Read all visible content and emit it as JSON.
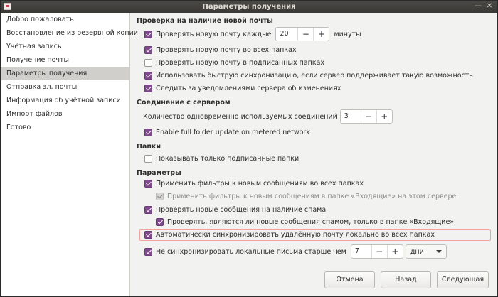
{
  "window": {
    "title": "Параметры получения",
    "close_glyph": "✕",
    "minimize_glyph": "—"
  },
  "sidebar": {
    "items": [
      {
        "label": "Добро пожаловать"
      },
      {
        "label": "Восстановление из резервной копии"
      },
      {
        "label": "Учётная запись"
      },
      {
        "label": "Получение почты"
      },
      {
        "label": "Параметры получения",
        "selected": true
      },
      {
        "label": "Отправка эл. почты"
      },
      {
        "label": "Информация об учётной записи"
      },
      {
        "label": "Импорт файлов"
      },
      {
        "label": "Готово"
      }
    ]
  },
  "sections": {
    "check_new_mail": {
      "title": "Проверка на наличие новой почты",
      "check_every_label": "Проверять новую почту каждые",
      "check_every_value": "20",
      "check_every_unit": "минуты",
      "all_folders_label": "Проверять новую почту во всех папках",
      "subscribed_folders_label": "Проверять новую почту в подписанных папках",
      "fast_sync_label": "Использовать быструю синхронизацию, если сервер поддерживает такую возможность",
      "notifications_label": "Следить за уведомлениями сервера об изменениях"
    },
    "server_connection": {
      "title": "Соединение с сервером",
      "connections_label": "Количество одновременно используемых соединений",
      "connections_value": "3",
      "metered_label": "Enable full folder update on metered network"
    },
    "folders": {
      "title": "Папки",
      "subscribed_only_label": "Показывать только подписанные папки"
    },
    "options": {
      "title": "Параметры",
      "filters_all_label": "Применить фильтры к новым сообщениям во всех папках",
      "filters_inbox_label": "Применить фильтры к новым сообщениям в папке «Входящие» на этом сервере",
      "spam_check_label": "Проверять новые сообщения на наличие спама",
      "spam_inbox_only_label": "Проверять, являются ли новые сообщения спамом, только в папке «Входящие»",
      "auto_sync_label": "Автоматически синхронизировать удалённую почту локально во всех папках",
      "no_sync_older_label": "Не синхронизировать локальные письма старше чем",
      "no_sync_older_value": "7",
      "no_sync_older_unit": "дни"
    }
  },
  "buttons": {
    "cancel": "Отмена",
    "back": "Назад",
    "next": "Следующая"
  },
  "spin": {
    "minus": "−",
    "plus": "+"
  },
  "colors": {
    "accent": "#7f4a8c",
    "focus": "#f2a49b",
    "selection": "#d0cfcb"
  }
}
